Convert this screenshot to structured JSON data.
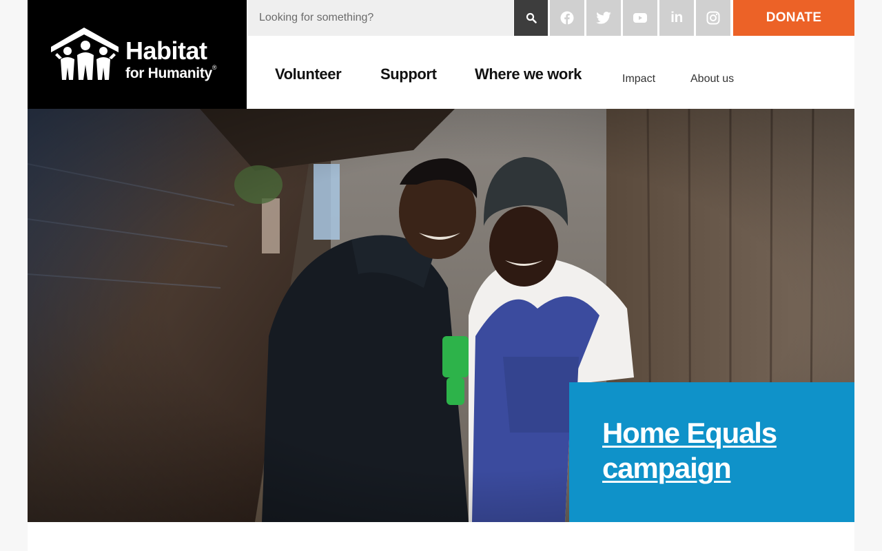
{
  "logo": {
    "line1": "Habitat",
    "line2": "for Humanity",
    "registered": "®",
    "icon": "habitat-house-people-icon"
  },
  "search": {
    "placeholder": "Looking for something?",
    "value": "",
    "icon": "search-icon"
  },
  "social": [
    {
      "name": "facebook",
      "icon": "facebook-icon"
    },
    {
      "name": "twitter",
      "icon": "twitter-icon"
    },
    {
      "name": "youtube",
      "icon": "youtube-icon"
    },
    {
      "name": "linkedin",
      "icon": "linkedin-icon",
      "glyph": "in"
    },
    {
      "name": "instagram",
      "icon": "instagram-icon"
    }
  ],
  "donate": {
    "label": "DONATE"
  },
  "nav": {
    "main": [
      "Volunteer",
      "Support",
      "Where we work"
    ],
    "secondary": [
      "Impact",
      "About us"
    ]
  },
  "hero": {
    "callout": "Home Equals campaign"
  },
  "colors": {
    "brand_orange": "#ec6227",
    "callout_blue": "#0f92c9",
    "logo_bg": "#000000",
    "search_btn": "#3d3d3d",
    "social_bg": "#d0d0d0"
  }
}
